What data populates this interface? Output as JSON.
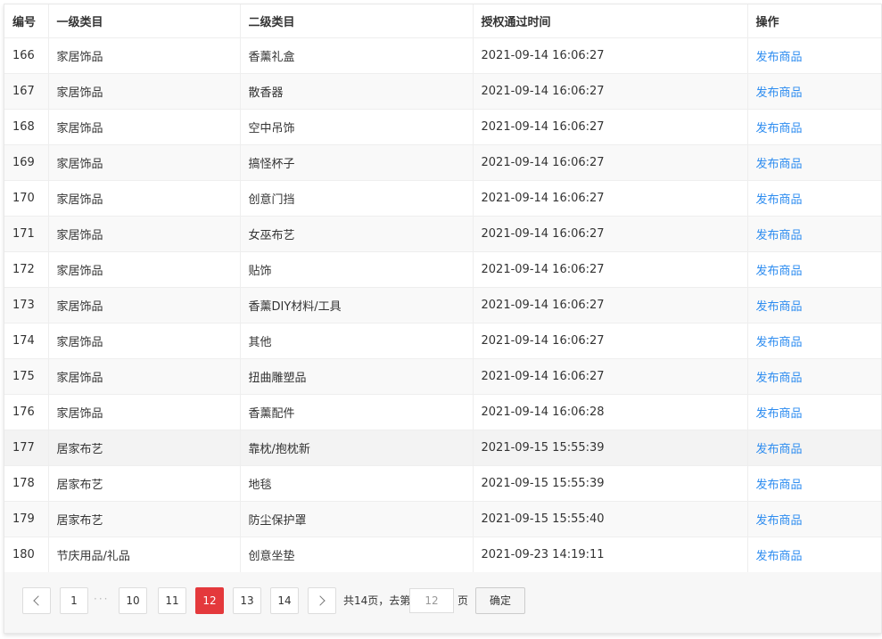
{
  "table": {
    "headers": [
      "编号",
      "一级类目",
      "二级类目",
      "授权通过时间",
      "操作"
    ],
    "rows": [
      {
        "id": "166",
        "cat1": "家居饰品",
        "cat2": "香薰礼盒",
        "time": "2021-09-14 16:06:27",
        "action": "发布商品"
      },
      {
        "id": "167",
        "cat1": "家居饰品",
        "cat2": "散香器",
        "time": "2021-09-14 16:06:27",
        "action": "发布商品"
      },
      {
        "id": "168",
        "cat1": "家居饰品",
        "cat2": "空中吊饰",
        "time": "2021-09-14 16:06:27",
        "action": "发布商品"
      },
      {
        "id": "169",
        "cat1": "家居饰品",
        "cat2": "搞怪杯子",
        "time": "2021-09-14 16:06:27",
        "action": "发布商品"
      },
      {
        "id": "170",
        "cat1": "家居饰品",
        "cat2": "创意门挡",
        "time": "2021-09-14 16:06:27",
        "action": "发布商品"
      },
      {
        "id": "171",
        "cat1": "家居饰品",
        "cat2": "女巫布艺",
        "time": "2021-09-14 16:06:27",
        "action": "发布商品"
      },
      {
        "id": "172",
        "cat1": "家居饰品",
        "cat2": "贴饰",
        "time": "2021-09-14 16:06:27",
        "action": "发布商品"
      },
      {
        "id": "173",
        "cat1": "家居饰品",
        "cat2": "香薰DIY材料/工具",
        "time": "2021-09-14 16:06:27",
        "action": "发布商品"
      },
      {
        "id": "174",
        "cat1": "家居饰品",
        "cat2": "其他",
        "time": "2021-09-14 16:06:27",
        "action": "发布商品"
      },
      {
        "id": "175",
        "cat1": "家居饰品",
        "cat2": "扭曲雕塑品",
        "time": "2021-09-14 16:06:27",
        "action": "发布商品"
      },
      {
        "id": "176",
        "cat1": "家居饰品",
        "cat2": "香薰配件",
        "time": "2021-09-14 16:06:28",
        "action": "发布商品"
      },
      {
        "id": "177",
        "cat1": "居家布艺",
        "cat2": "靠枕/抱枕新",
        "time": "2021-09-15 15:55:39",
        "action": "发布商品"
      },
      {
        "id": "178",
        "cat1": "居家布艺",
        "cat2": "地毯",
        "time": "2021-09-15 15:55:39",
        "action": "发布商品"
      },
      {
        "id": "179",
        "cat1": "居家布艺",
        "cat2": "防尘保护罩",
        "time": "2021-09-15 15:55:40",
        "action": "发布商品"
      },
      {
        "id": "180",
        "cat1": "节庆用品/礼品",
        "cat2": "创意坐垫",
        "time": "2021-09-23 14:19:11",
        "action": "发布商品"
      }
    ]
  },
  "pagination": {
    "pages": [
      "1",
      "10",
      "11",
      "12",
      "13",
      "14"
    ],
    "ellipsis": "···",
    "current": "12",
    "total_text": "共14页，去第",
    "goto_value": "12",
    "page_suffix": "页",
    "confirm_label": "确定"
  },
  "colors": {
    "accent": "#e4393c",
    "link": "#2d8cf0"
  }
}
